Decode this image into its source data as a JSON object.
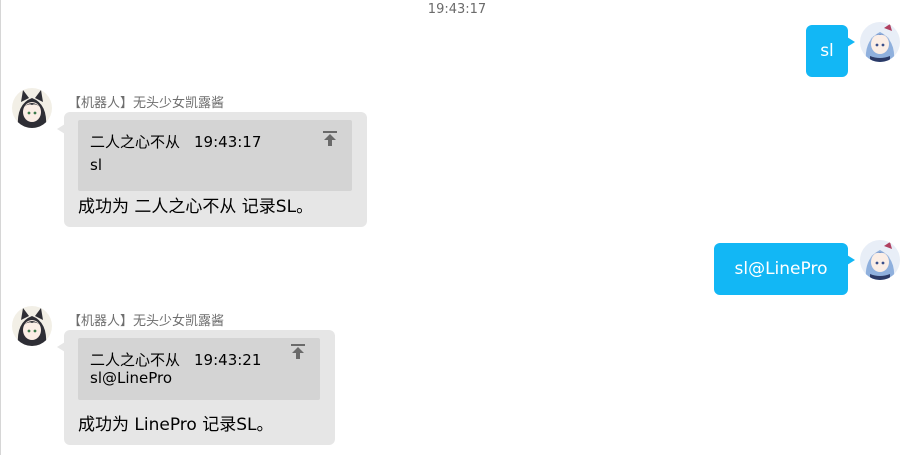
{
  "chat": {
    "timestamp": "19:43:17",
    "messages": [
      {
        "direction": "outgoing",
        "text": "sl"
      },
      {
        "direction": "incoming",
        "sender": "【机器人】无头少女凯露酱",
        "quote": {
          "author": "二人之心不从",
          "time": "19:43:17",
          "text": "sl"
        },
        "text": "成功为 二人之心不从 记录SL。"
      },
      {
        "direction": "outgoing",
        "text": "sl@LinePro"
      },
      {
        "direction": "incoming",
        "sender": "【机器人】无头少女凯露酱",
        "quote": {
          "author": "二人之心不从",
          "time": "19:43:21",
          "text": "sl@LinePro"
        },
        "text": "成功为 LinePro 记录SL。"
      }
    ]
  },
  "colors": {
    "outgoing_bubble": "#12b7f5",
    "incoming_bubble": "#e6e6e6",
    "quote_bg": "#d4d4d4"
  },
  "icons": {
    "quote_jump": "jump-to-top-icon",
    "user_avatar": "anime-girl-avatar",
    "bot_avatar": "cat-ear-girl-avatar"
  }
}
